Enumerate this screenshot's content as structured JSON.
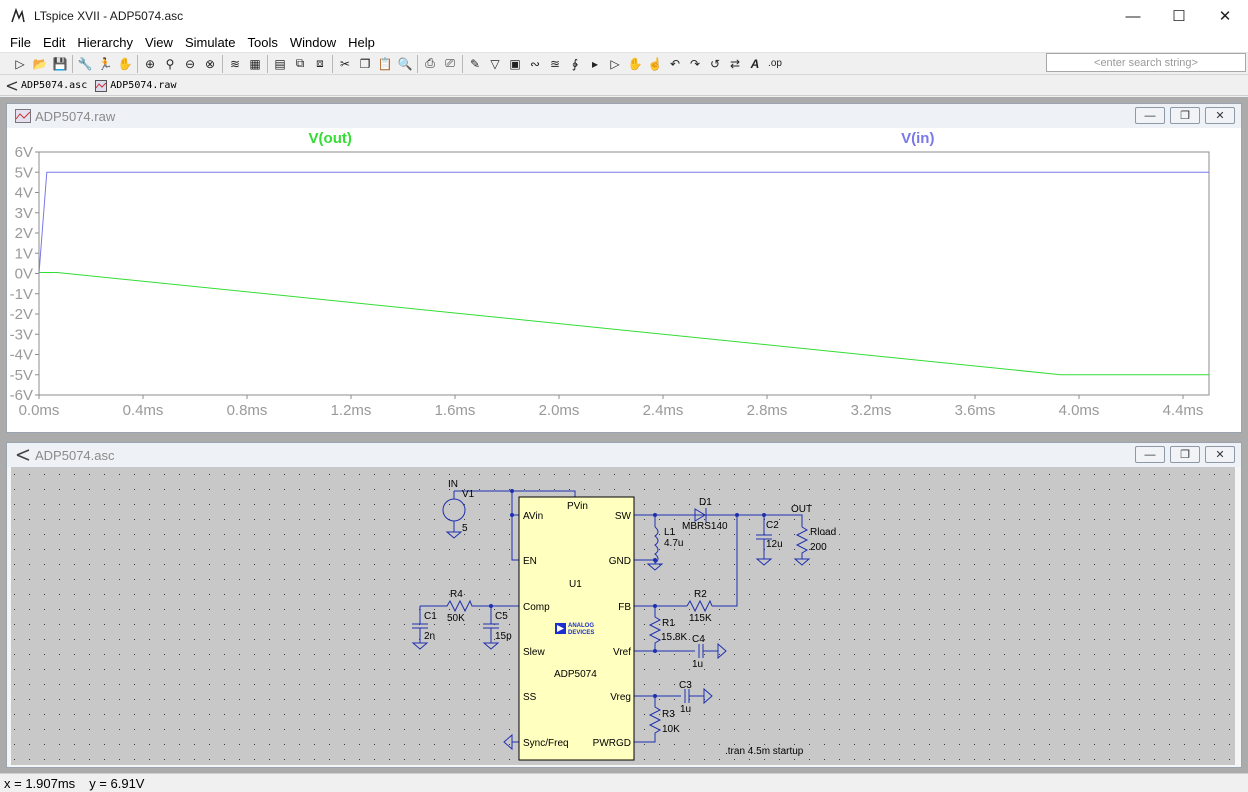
{
  "window": {
    "title": "LTspice XVII - ADP5074.asc"
  },
  "menu": [
    "File",
    "Edit",
    "Hierarchy",
    "View",
    "Simulate",
    "Tools",
    "Window",
    "Help"
  ],
  "search": {
    "placeholder": "<enter search string>"
  },
  "tabs": [
    {
      "label": "ADP5074.asc",
      "icon": "schematic-icon"
    },
    {
      "label": "ADP5074.raw",
      "icon": "waveform-icon"
    }
  ],
  "waveform_window": {
    "title": "ADP5074.raw"
  },
  "schematic_window": {
    "title": "ADP5074.asc"
  },
  "status": {
    "x": "x = 1.907ms",
    "y": "y = 6.91V"
  },
  "chart_data": {
    "type": "line",
    "title": "",
    "xlabel": "",
    "ylabel": "",
    "xlim": [
      0,
      4.5
    ],
    "ylim": [
      -6,
      6
    ],
    "x_ticks": [
      "0.0ms",
      "0.4ms",
      "0.8ms",
      "1.2ms",
      "1.6ms",
      "2.0ms",
      "2.4ms",
      "2.8ms",
      "3.2ms",
      "3.6ms",
      "4.0ms",
      "4.4ms"
    ],
    "y_ticks": [
      "6V",
      "5V",
      "4V",
      "3V",
      "2V",
      "1V",
      "0V",
      "-1V",
      "-2V",
      "-3V",
      "-4V",
      "-5V",
      "-6V"
    ],
    "series": [
      {
        "name": "V(out)",
        "color": "#33dd33",
        "x": [
          0,
          0.07,
          3.93,
          4.5
        ],
        "y": [
          0.05,
          0.05,
          -5.0,
          -5.0
        ]
      },
      {
        "name": "V(in)",
        "color": "#7878e8",
        "x": [
          0,
          0.03,
          4.5
        ],
        "y": [
          0,
          5.0,
          5.0
        ]
      }
    ]
  },
  "schematic": {
    "ic": {
      "name": "U1",
      "part": "ADP5074",
      "logo": "ANALOG DEVICES",
      "pins_left": [
        "AVin",
        "EN",
        "Comp",
        "Slew",
        "SS",
        "Sync/Freq"
      ],
      "pins_right": [
        "SW",
        "GND",
        "FB",
        "Vref",
        "Vreg",
        "PWRGD"
      ],
      "pin_top": "PVin"
    },
    "labels": {
      "in_net": "IN",
      "v1": "V1",
      "v1_val": "5",
      "d1": "D1",
      "d1_val": "MBRS140",
      "l1": "L1",
      "l1_val": "4.7u",
      "c2": "C2",
      "c2_val": "12u",
      "out_net": "OUT",
      "rload": "Rload",
      "rload_val": "200",
      "r2": "R2",
      "r2_val": "115K",
      "r1": "R1",
      "r1_val": "15.8K",
      "c4": "C4",
      "c4_val": "1u",
      "c3": "C3",
      "c3_val": "1u",
      "r3": "R3",
      "r3_val": "10K",
      "r4": "R4",
      "r4_val": "50K",
      "c1": "C1",
      "c1_val": "2n",
      "c5": "C5",
      "c5_val": "15p",
      "directive": ".tran 4.5m startup"
    }
  }
}
